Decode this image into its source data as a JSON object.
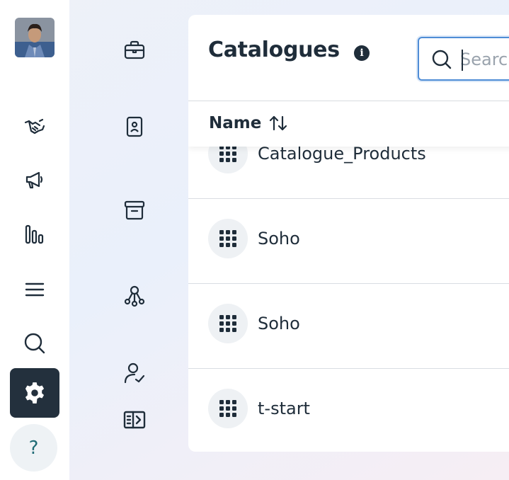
{
  "sidebar": {
    "items": [
      {
        "icon": "handshake-icon"
      },
      {
        "icon": "megaphone-icon"
      },
      {
        "icon": "bar-chart-icon"
      },
      {
        "icon": "menu-icon"
      },
      {
        "icon": "search-icon"
      },
      {
        "icon": "gear-icon",
        "active": true
      }
    ],
    "help_label": "?"
  },
  "subnav": {
    "items": [
      {
        "icon": "briefcase-icon"
      },
      {
        "icon": "contact-card-icon"
      },
      {
        "icon": "archive-icon"
      },
      {
        "icon": "network-icon"
      },
      {
        "icon": "user-check-icon"
      },
      {
        "icon": "panel-toggle-icon"
      }
    ]
  },
  "page": {
    "title": "Catalogues",
    "search_placeholder": "Search"
  },
  "table": {
    "column_name": "Name",
    "rows": [
      {
        "label": "Catalogue_Products"
      },
      {
        "label": "Soho"
      },
      {
        "label": "Soho"
      },
      {
        "label": "t-start"
      }
    ]
  },
  "colors": {
    "accent": "#4f8dd6",
    "dark": "#23303d",
    "text": "#1f2d3a"
  }
}
